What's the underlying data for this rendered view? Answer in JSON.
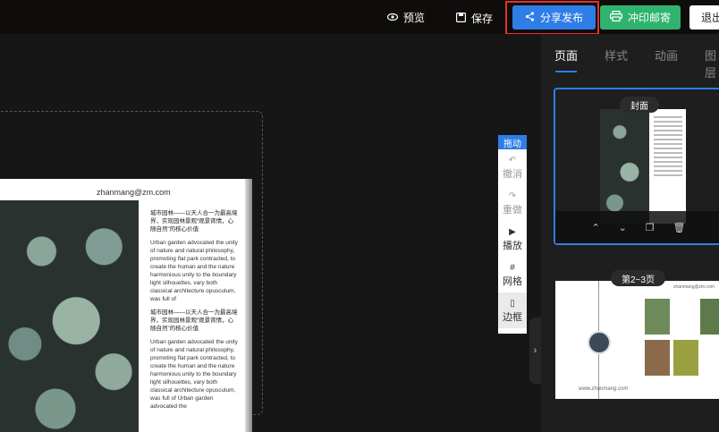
{
  "topbar": {
    "preview_label": "预览",
    "save_label": "保存",
    "share_label": "分享发布",
    "mail_label": "冲印邮寄",
    "exit_label": "退出"
  },
  "book": {
    "email": "zhanmang@zm.com",
    "paragraphs": [
      "城市园林——以天人合一为最高境界，实现园林景观“观景宵情，心随自然”的核心价值",
      "Urban garden advocated the unity of nature and natural philosophy, promoting flat park contracted, to create the human and the nature harmonious unity to the boundary light silhouettes, vary both classical architecture opusculum, was full of",
      "城市园林——以天人合一为最高境界，实现园林景观“观景宵情，心随自然”的核心价值",
      "Urban garden advocated the unity of nature and natural philosophy, promoting flat park contracted, to create the human and the nature harmonious unity to the boundary light silhouettes, vary both classical architecture opusculum, was full of Urban garden advocated the"
    ]
  },
  "toolbox": {
    "drag_label": "拖动",
    "undo_label": "撤消",
    "redo_label": "重做",
    "play_label": "播放",
    "grid_label": "网格",
    "border_label": "边框"
  },
  "panel": {
    "tabs": [
      "页面",
      "样式",
      "动画",
      "图层"
    ],
    "card1_label": "封面",
    "card2_label": "第2~3页",
    "card2_email": "zhanmang@zm.com",
    "card2_footer": "www.zhanmang.com"
  }
}
